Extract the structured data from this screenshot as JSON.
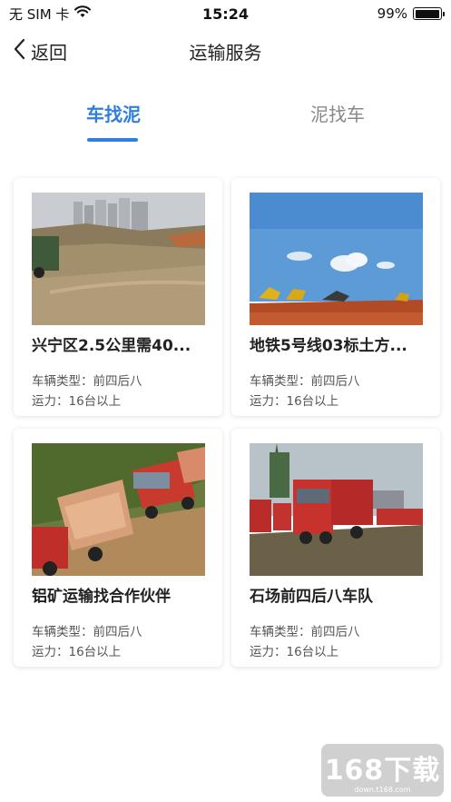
{
  "status_bar": {
    "carrier": "无 SIM 卡",
    "time": "15:24",
    "battery_text": "99%",
    "battery_level": 0.99
  },
  "nav": {
    "back_label": "返回",
    "title": "运输服务"
  },
  "tabs": [
    {
      "label": "车找泥",
      "active": true
    },
    {
      "label": "泥找车",
      "active": false
    }
  ],
  "cards": [
    {
      "title": "兴宁区2.5公里需40...",
      "type_text": "车辆类型：前四后八",
      "capacity_text": "运力：16台以上"
    },
    {
      "title": "地铁5号线03标土方...",
      "type_text": "车辆类型：前四后八",
      "capacity_text": "运力：16台以上"
    },
    {
      "title": "铝矿运输找合作伙伴",
      "type_text": "车辆类型：前四后八",
      "capacity_text": "运力：16台以上"
    },
    {
      "title": "石场前四后八车队",
      "type_text": "车辆类型：前四后八",
      "capacity_text": "运力：16台以上"
    }
  ],
  "watermark": {
    "text": "168下载",
    "sub": "down.t168.com"
  },
  "colors": {
    "accent": "#2f7fe0",
    "inactive_tab": "#888888"
  }
}
